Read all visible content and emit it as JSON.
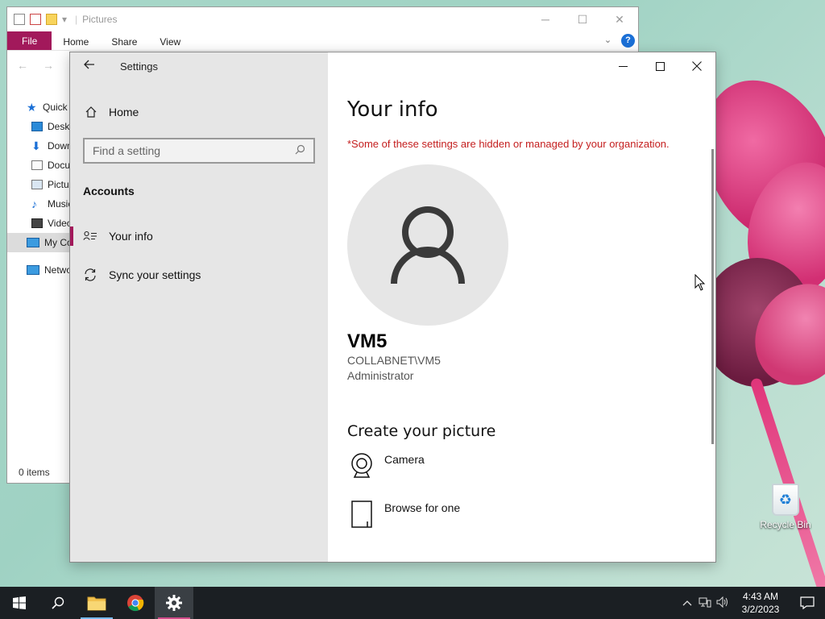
{
  "explorer": {
    "title": "Pictures",
    "ribbon_tabs": [
      "File",
      "Home",
      "Share",
      "View"
    ],
    "help_label": "?",
    "tree": [
      "Quick access",
      "Desktop",
      "Downloads",
      "Documents",
      "Pictures",
      "Music",
      "Videos",
      "My Computer",
      "Network"
    ],
    "status": "0 items"
  },
  "settings": {
    "app_title": "Settings",
    "home_label": "Home",
    "search_placeholder": "Find a setting",
    "section_label": "Accounts",
    "nav": [
      {
        "label": "Your info",
        "icon": "user-card-icon",
        "active": true
      },
      {
        "label": "Sync your settings",
        "icon": "sync-icon",
        "active": false
      }
    ],
    "page_title": "Your info",
    "managed_warning": "*Some of these settings are hidden or managed by your organization.",
    "user": {
      "name": "VM5",
      "domain": "COLLABNET\\VM5",
      "role": "Administrator"
    },
    "create_picture_heading": "Create your picture",
    "picture_options": [
      "Camera",
      "Browse for one"
    ]
  },
  "desktop": {
    "recycle_bin_label": "Recycle Bin"
  },
  "taskbar": {
    "time": "4:43 AM",
    "date": "3/2/2023"
  },
  "colors": {
    "accent": "#a2195b",
    "warning": "#c41e1e",
    "sidebar_bg": "#e6e6e6",
    "taskbar_bg": "#1b1f23"
  }
}
